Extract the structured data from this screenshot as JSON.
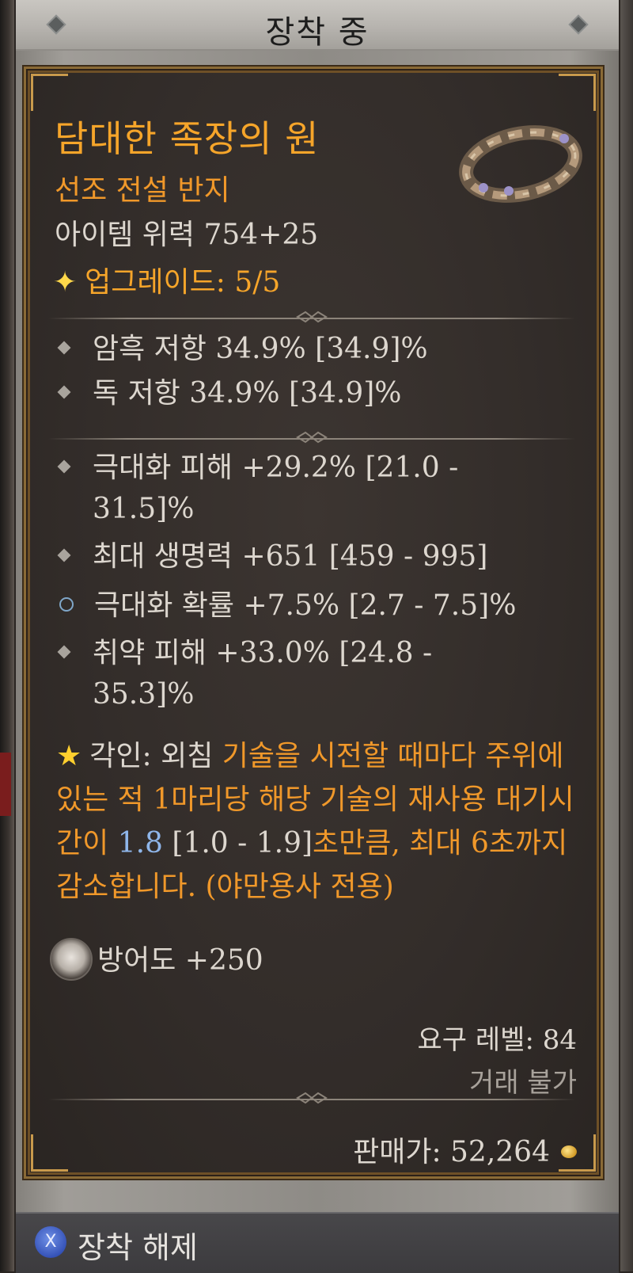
{
  "header": {
    "title": "장착 중"
  },
  "item": {
    "name": "담대한 족장의 원",
    "type": "선조 전설 반지",
    "power": "아이템 위력 754+25",
    "upgrade": "업그레이드: 5/5",
    "icon": "ring-icon"
  },
  "resistances": [
    "암흑 저항 34.9% [34.9]%",
    "독 저항 34.9% [34.9]%"
  ],
  "affixes": [
    {
      "line1": "극대화 피해 +29.2% [21.0 -",
      "line2": "31.5]%"
    },
    {
      "line1": "최대 생명력 +651 [459 - 995]"
    },
    {
      "line1": "극대화 확률 +7.5% [2.7 - 7.5]%"
    },
    {
      "line1": "취약 피해 +33.0% [24.8 -",
      "line2": "35.3]%"
    }
  ],
  "aspect": {
    "prefix": "각인: 외침",
    "text1": " 기술을 시전할 때마다 주위에 있는 적 1마리당 해당 기술의 재사용 대기시간이 ",
    "value": "1.8",
    "range": " [1.0 - 1.9]",
    "text2": "초만큼, 최대 6초까지 감소합니다. (야만용사 전용)"
  },
  "armor": {
    "text": "방어도 +250",
    "icon": "skull-icon"
  },
  "requirements": {
    "level": "요구 레벨: 84",
    "trade": "거래 불가"
  },
  "sell": {
    "text": "판매가: 52,264",
    "icon": "gold-coin-icon"
  },
  "action": {
    "button": "X",
    "label": "장착 해제"
  },
  "colors": {
    "legendary": "#f6a52a",
    "text": "#ddd7cf",
    "reroll": "#8fb6ea"
  }
}
